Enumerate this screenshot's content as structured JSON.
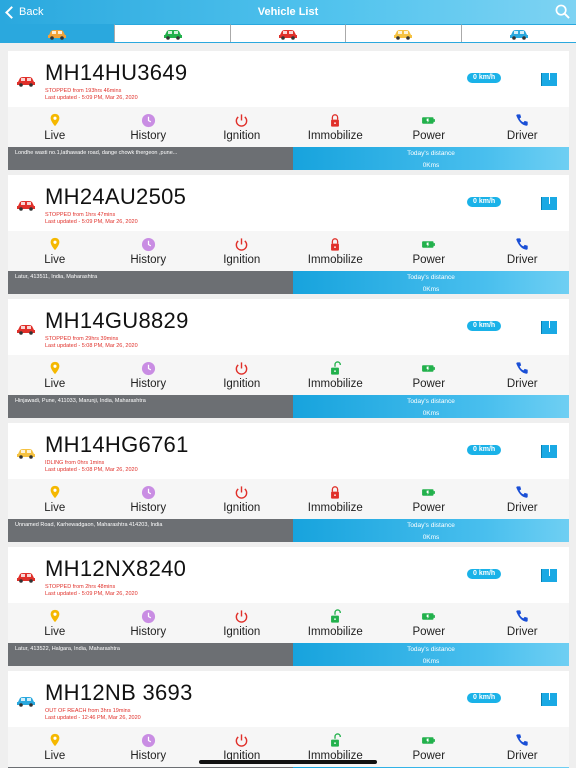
{
  "header": {
    "back_label": "Back",
    "title": "Vehicle List"
  },
  "filters": [
    {
      "name": "all",
      "color": "#f2a33a",
      "active": true
    },
    {
      "name": "running",
      "color": "#22b14c",
      "active": false
    },
    {
      "name": "stopped",
      "color": "#e0302a",
      "active": false
    },
    {
      "name": "idle",
      "color": "#f5c242",
      "active": false
    },
    {
      "name": "out-of-reach",
      "color": "#2aa8de",
      "active": false
    }
  ],
  "actions": [
    "Live",
    "History",
    "Ignition",
    "Immobilize",
    "Power",
    "Driver"
  ],
  "distance_label": "Today's distance",
  "vehicles": [
    {
      "plate": "MH14HU3649",
      "status": "STOPPED from 193hrs 46mins",
      "updated": "Last updated - 5:09 PM, Mar 26, 2020",
      "speed": "0 km/h",
      "car_color": "#e0302a",
      "immobilize": "locked",
      "address": "Londhe wasti no.1,lathawade road, dange chowk thergeon ,pune...",
      "distance": "0Kms"
    },
    {
      "plate": "MH24AU2505",
      "status": "STOPPED from 1hrs 47mins",
      "updated": "Last updated - 5:09 PM, Mar 26, 2020",
      "speed": "0 km/h",
      "car_color": "#e0302a",
      "immobilize": "locked",
      "address": "Latur, 413511, India, Maharashtra",
      "distance": "0Kms"
    },
    {
      "plate": "MH14GU8829",
      "status": "STOPPED from 29hrs 39mins",
      "updated": "Last updated - 5:08 PM, Mar 26, 2020",
      "speed": "0 km/h",
      "car_color": "#e0302a",
      "immobilize": "unlocked",
      "address": "Hinjawadi, Pune, 411033, Marunji, India, Maharashtra",
      "distance": "0Kms"
    },
    {
      "plate": "MH14HG6761",
      "status": "IDLING from 0hrs 1mins",
      "updated": "Last updated - 5:08 PM, Mar 26, 2020",
      "speed": "0 km/h",
      "car_color": "#f5c242",
      "immobilize": "locked",
      "address": "Unnamed Road, Karhewadgaon, Maharashtra 414203, India",
      "distance": "0Kms"
    },
    {
      "plate": "MH12NX8240",
      "status": "STOPPED from 2hrs 48mins",
      "updated": "Last updated - 5:09 PM, Mar 26, 2020",
      "speed": "0 km/h",
      "car_color": "#e0302a",
      "immobilize": "unlocked",
      "address": "Latur, 413522, Halgara, India, Maharashtra",
      "distance": "0Kms"
    },
    {
      "plate": "MH12NB 3693",
      "status": "OUT OF REACH from 3hrs 19mins",
      "updated": "Last updated - 12:46 PM, Mar 26, 2020",
      "speed": "0 km/h",
      "car_color": "#2aa8de",
      "immobilize": "unlocked",
      "address": "",
      "distance": ""
    }
  ],
  "colors": {
    "accent": "#2aa8de",
    "live": "#f5b800",
    "history": "#c98de3",
    "ignition": "#e0302a",
    "locked": "#e0302a",
    "unlocked": "#22b14c",
    "power": "#22b14c",
    "driver": "#1a4fd6"
  }
}
